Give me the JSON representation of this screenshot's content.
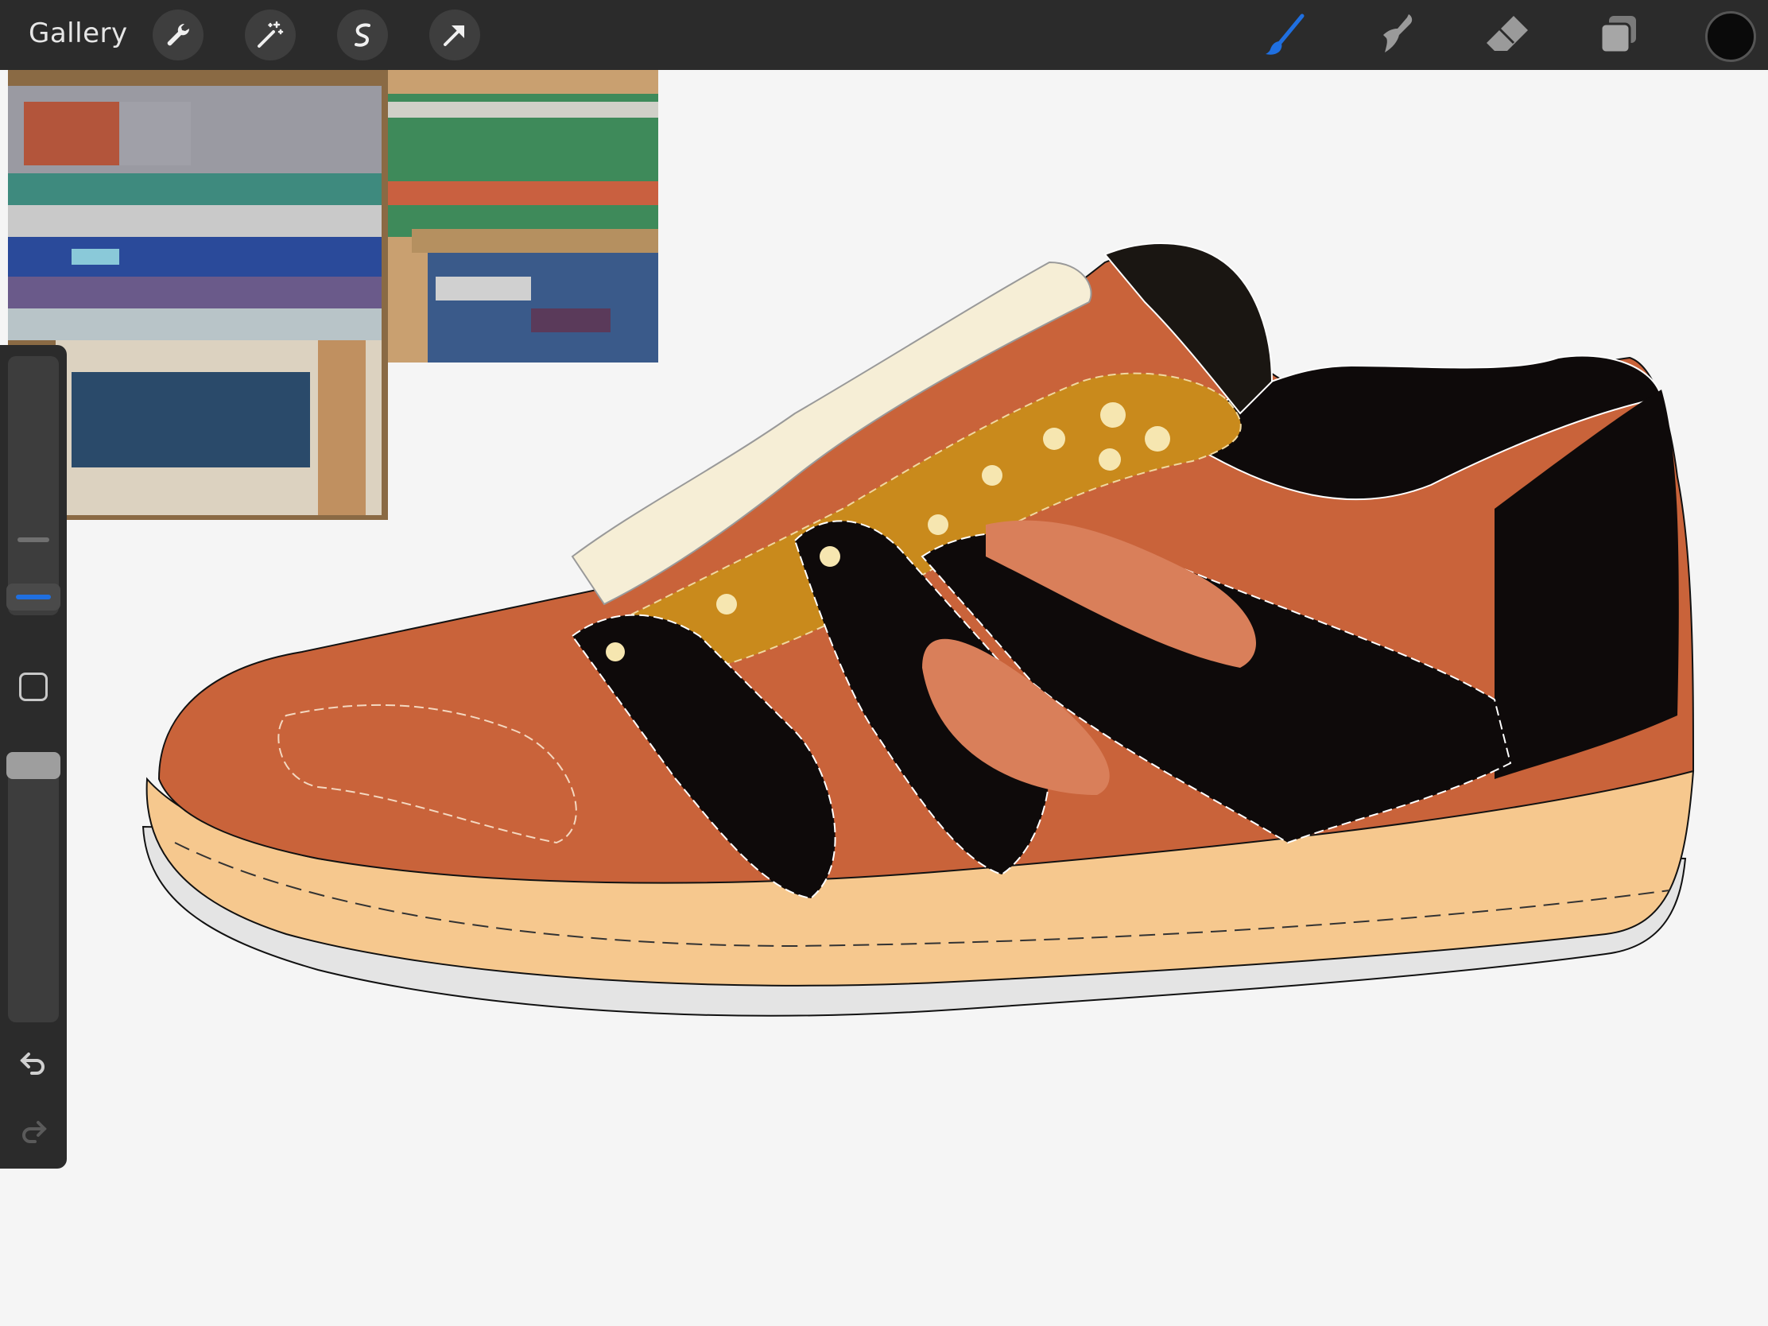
{
  "app": {
    "gallery_label": "Gallery"
  },
  "toolbar_left": [
    {
      "name": "wrench-icon"
    },
    {
      "name": "magic-wand-icon"
    },
    {
      "name": "selection-icon"
    },
    {
      "name": "transform-arrow-icon"
    }
  ],
  "toolbar_right": [
    {
      "name": "brush-icon",
      "active": true
    },
    {
      "name": "smudge-icon"
    },
    {
      "name": "eraser-icon"
    },
    {
      "name": "layers-icon"
    }
  ],
  "colors": {
    "accent": "#1f6fe0",
    "current_color": "#0a0a0a",
    "shoe_upper": "#c9633a",
    "shoe_sole": "#f6c88e",
    "shoe_black": "#0e0a0a",
    "shoe_mustard": "#c98a1c",
    "shoe_cream": "#f6eed6"
  },
  "sidebar": {
    "brush_size_level": 0.32,
    "opacity_level": 0.0,
    "modify_button": "square-icon",
    "undo_icon": "undo-icon",
    "redo_icon": "redo-icon"
  }
}
